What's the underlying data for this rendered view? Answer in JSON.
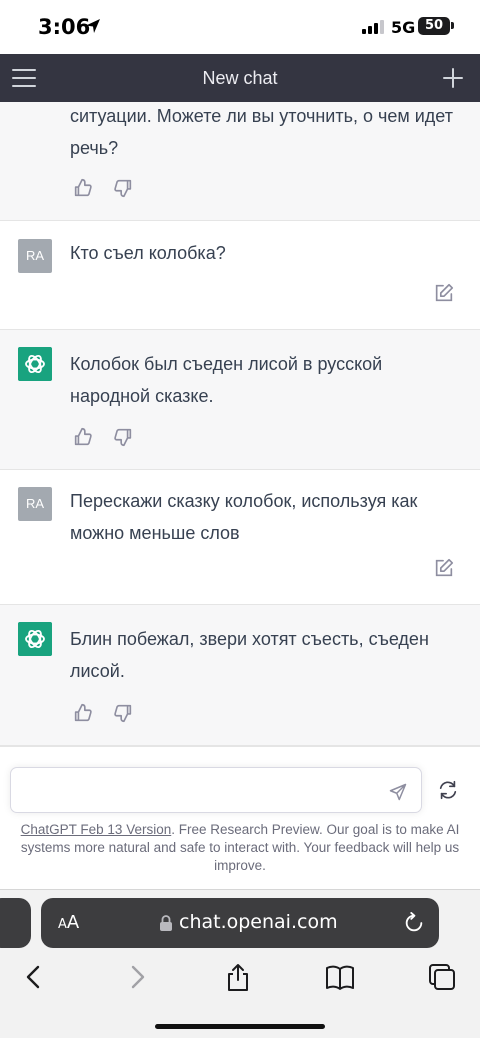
{
  "status_bar": {
    "time": "3:06",
    "network": "5G",
    "battery": "50"
  },
  "header": {
    "title": "New chat",
    "menu_icon": "hamburger-menu-icon",
    "new_chat_icon": "plus-icon"
  },
  "messages": [
    {
      "role": "assistant",
      "text": "ситуации. Можете ли вы уточнить, о чем идет речь?"
    },
    {
      "role": "user",
      "avatar": "RA",
      "text": "Кто съел колобка?"
    },
    {
      "role": "assistant",
      "text": "Колобок был съеден лисой в русской народной сказке."
    },
    {
      "role": "user",
      "avatar": "RA",
      "text": "Перескажи сказку колобок, используя как можно меньше слов"
    },
    {
      "role": "assistant",
      "text": "Блин побежал, звери хотят съесть, съеден лисой."
    }
  ],
  "composer": {
    "value": "",
    "placeholder": ""
  },
  "footer": {
    "version_link": "ChatGPT Feb 13 Version",
    "note": ". Free Research Preview. Our goal is to make AI systems more natural and safe to interact with. Your feedback will help us improve."
  },
  "browser": {
    "text_size_label_small": "A",
    "text_size_label_large": "A",
    "url": "chat.openai.com"
  },
  "colors": {
    "nav_bg": "#343541",
    "assistant_bg": "#f7f7f8",
    "gpt_avatar": "#19a37f",
    "user_avatar": "#a3a9b0"
  }
}
